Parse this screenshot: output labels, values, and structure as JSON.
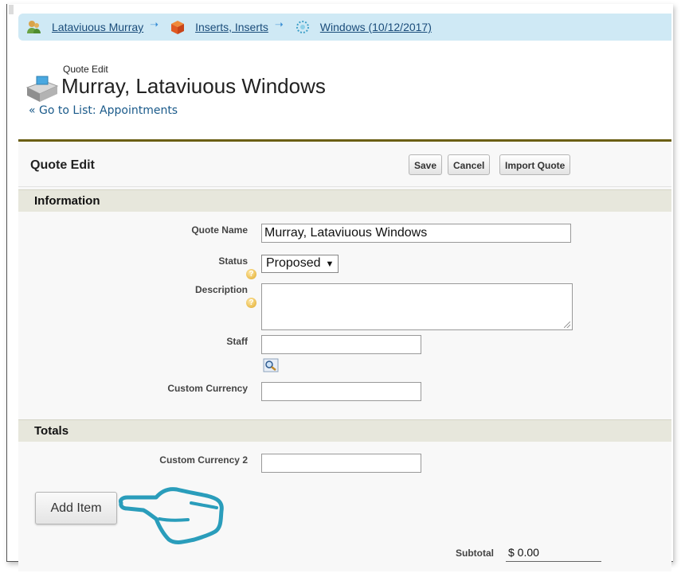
{
  "breadcrumb": {
    "items": [
      {
        "label": "Lataviuous Murray",
        "icon": "person-icon"
      },
      {
        "label": "Inserts, Inserts",
        "icon": "package-icon"
      },
      {
        "label": "Windows (10/12/2017)",
        "icon": "appointment-icon"
      }
    ],
    "separator_icon": "arrow-right-icon"
  },
  "header": {
    "subtitle": "Quote Edit",
    "title": "Murray, Lataviuous Windows",
    "back_link": "« Go to List: Appointments",
    "icon": "quote-icon"
  },
  "panel": {
    "title": "Quote Edit",
    "buttons": {
      "save": "Save",
      "cancel": "Cancel",
      "import": "Import Quote"
    },
    "accent_color": "#6b5f14"
  },
  "information": {
    "section_title": "Information",
    "quote_name_label": "Quote Name",
    "quote_name_value": "Murray, Lataviuous Windows",
    "status_label": "Status",
    "status_value": "Proposed",
    "description_label": "Description",
    "description_value": "",
    "staff_label": "Staff",
    "staff_value": "",
    "custom_currency_label": "Custom Currency",
    "custom_currency_value": ""
  },
  "totals": {
    "section_title": "Totals",
    "custom_currency2_label": "Custom Currency 2",
    "custom_currency2_value": "",
    "add_item_label": "Add Item",
    "subtotal_label": "Subtotal",
    "subtotal_value": "$ 0.00"
  },
  "annotation": {
    "icon": "pointing-hand-icon",
    "color": "#2a9dbb"
  }
}
